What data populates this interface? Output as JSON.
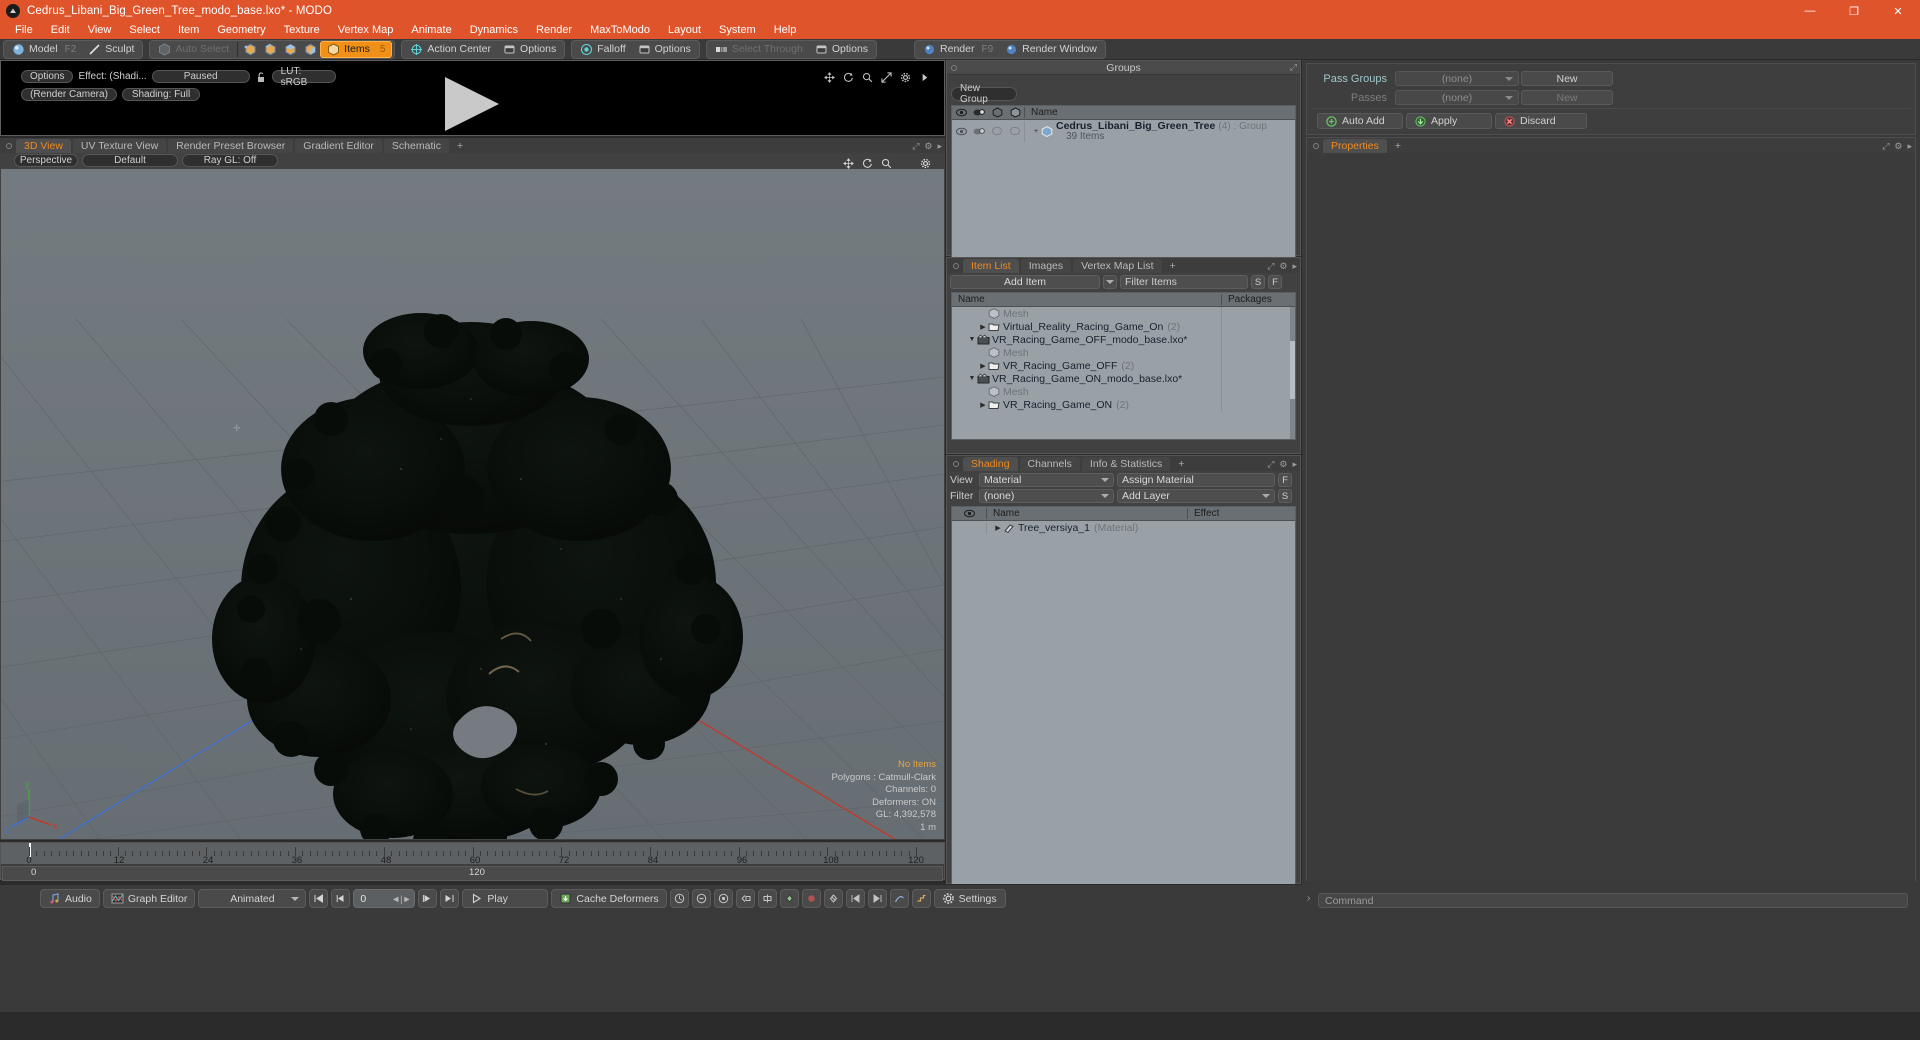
{
  "titlebar": {
    "title": "Cedrus_Libani_Big_Green_Tree_modo_base.lxo* - MODO",
    "minimize": "—",
    "maximize": "❐",
    "close": "✕"
  },
  "menubar": {
    "items": [
      "File",
      "Edit",
      "View",
      "Select",
      "Item",
      "Geometry",
      "Texture",
      "Vertex Map",
      "Animate",
      "Dynamics",
      "Render",
      "MaxToModo",
      "Layout",
      "System",
      "Help"
    ]
  },
  "toolbar": {
    "model": "Model",
    "model_key": "F2",
    "sculpt": "Sculpt",
    "auto_select": "Auto Select",
    "items": "Items",
    "items_num": "5",
    "action_center": "Action Center",
    "options1": "Options",
    "falloff": "Falloff",
    "options2": "Options",
    "select_through": "Select Through",
    "options3": "Options",
    "render": "Render",
    "render_key": "F9",
    "render_window": "Render Window"
  },
  "render_preview": {
    "options": "Options",
    "effect": "Effect: (Shadi...",
    "paused": "Paused",
    "lut": "LUT: sRGB",
    "camera": "(Render Camera)",
    "shading": "Shading: Full"
  },
  "viewport": {
    "tabs": [
      {
        "label": "3D View",
        "active": true
      },
      {
        "label": "UV Texture View",
        "active": false
      },
      {
        "label": "Render Preset Browser",
        "active": false
      },
      {
        "label": "Gradient Editor",
        "active": false
      },
      {
        "label": "Schematic",
        "active": false
      },
      {
        "label": "+",
        "active": false
      }
    ],
    "controls": [
      "Perspective",
      "Default",
      "Ray GL: Off"
    ],
    "stats": {
      "items": "No Items",
      "polygons": "Polygons : Catmull-Clark",
      "channels": "Channels: 0",
      "deformers": "Deformers: ON",
      "gl": "GL: 4,392,578",
      "scale": "1 m"
    },
    "axis": {
      "x": "x",
      "y": "y",
      "z": "z"
    }
  },
  "timeline": {
    "ticks": [
      "0",
      "12",
      "24",
      "36",
      "48",
      "60",
      "72",
      "84",
      "96",
      "108",
      "120"
    ],
    "range_start": "0",
    "range_end": "120",
    "current_frame": "0"
  },
  "transport": {
    "audio": "Audio",
    "graph_editor": "Graph Editor",
    "mode": "Animated",
    "frame_value": "0",
    "play": "Play",
    "cache_deformers": "Cache Deformers",
    "settings": "Settings"
  },
  "groups_panel": {
    "title": "Groups",
    "new_group": "New Group",
    "columns": [
      "Name"
    ],
    "rows": [
      {
        "name": "Cedrus_Libani_Big_Green_Tree",
        "count": "(4)",
        "type": ": Group",
        "sub": "39 Items"
      }
    ]
  },
  "item_list_panel": {
    "tabs": [
      {
        "label": "Item List",
        "active": true
      },
      {
        "label": "Images",
        "active": false
      },
      {
        "label": "Vertex Map List",
        "active": false
      },
      {
        "label": "+",
        "active": false
      }
    ],
    "add_item": "Add Item",
    "filter_placeholder": "Filter Items",
    "btn_s": "S",
    "btn_f": "F",
    "columns": [
      "Name",
      "Packages"
    ],
    "rows": [
      {
        "label": "Mesh",
        "count": "",
        "indent": 2,
        "icon": "mesh",
        "dim": true,
        "twist": ""
      },
      {
        "label": "Virtual_Reality_Racing_Game_On",
        "count": "(2)",
        "indent": 2,
        "icon": "folder",
        "dim": false,
        "twist": "▶"
      },
      {
        "label": "VR_Racing_Game_OFF_modo_base.lxo*",
        "count": "",
        "indent": 1,
        "icon": "scene",
        "dim": false,
        "twist": "▼"
      },
      {
        "label": "Mesh",
        "count": "",
        "indent": 2,
        "icon": "mesh",
        "dim": true,
        "twist": ""
      },
      {
        "label": "VR_Racing_Game_OFF",
        "count": "(2)",
        "indent": 2,
        "icon": "folder",
        "dim": false,
        "twist": "▶"
      },
      {
        "label": "VR_Racing_Game_ON_modo_base.lxo*",
        "count": "",
        "indent": 1,
        "icon": "scene",
        "dim": false,
        "twist": "▼"
      },
      {
        "label": "Mesh",
        "count": "",
        "indent": 2,
        "icon": "mesh",
        "dim": true,
        "twist": ""
      },
      {
        "label": "VR_Racing_Game_ON",
        "count": "(2)",
        "indent": 2,
        "icon": "folder",
        "dim": false,
        "twist": "▶"
      }
    ]
  },
  "shading_panel": {
    "tabs": [
      {
        "label": "Shading",
        "active": true
      },
      {
        "label": "Channels",
        "active": false
      },
      {
        "label": "Info & Statistics",
        "active": false
      },
      {
        "label": "+",
        "active": false
      }
    ],
    "view_label": "View",
    "view_value": "Material",
    "assign_material": "Assign Material",
    "btn_f": "F",
    "filter_label": "Filter",
    "filter_value": "(none)",
    "add_layer": "Add Layer",
    "btn_s": "S",
    "columns": [
      "Name",
      "Effect"
    ],
    "rows": [
      {
        "name": "Tree_versiya_1",
        "type": "(Material)",
        "effect": ""
      }
    ]
  },
  "passes_panel": {
    "pass_groups_label": "Pass Groups",
    "pass_groups_value": "(none)",
    "pass_groups_new": "New",
    "passes_label": "Passes",
    "passes_value": "(none)",
    "passes_new": "New",
    "auto_add": "Auto Add",
    "apply": "Apply",
    "discard": "Discard"
  },
  "properties_panel": {
    "tabs": [
      {
        "label": "Properties",
        "active": true
      },
      {
        "label": "+",
        "active": false
      }
    ]
  },
  "command_bar": {
    "placeholder": "Command",
    "arrow": "›"
  },
  "colors": {
    "accent_orange": "#e0542b",
    "tab_orange": "#f08a1e",
    "panel_bg": "#414141",
    "list_bg": "#9aa1a6",
    "viewport_bg": "#6d7478"
  }
}
